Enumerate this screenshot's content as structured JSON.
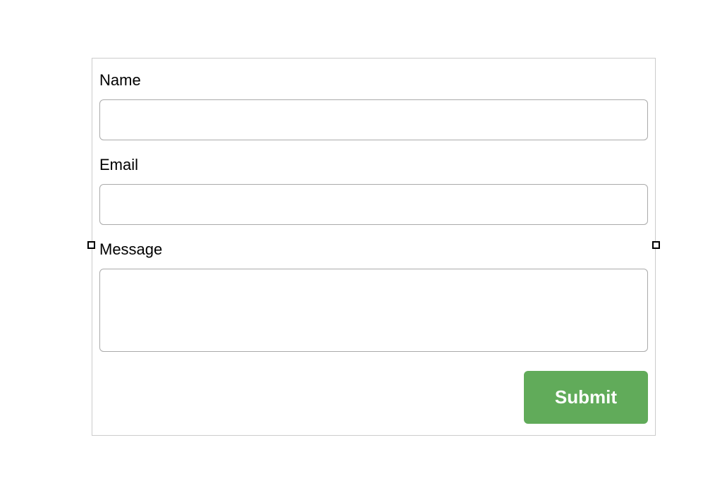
{
  "form": {
    "fields": {
      "name": {
        "label": "Name",
        "value": ""
      },
      "email": {
        "label": "Email",
        "value": ""
      },
      "message": {
        "label": "Message",
        "value": ""
      }
    },
    "submit_label": "Submit"
  }
}
